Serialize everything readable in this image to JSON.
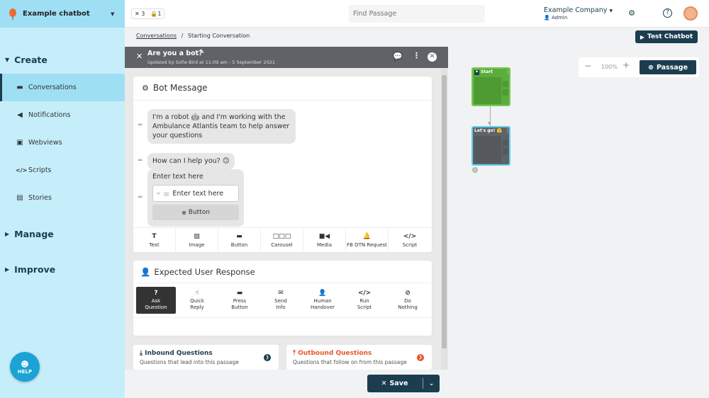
{
  "sidebar": {
    "chatbot_name": "Example chatbot",
    "groups": {
      "create": "Create",
      "manage": "Manage",
      "improve": "Improve"
    },
    "items": [
      {
        "label": "Conversations",
        "icon": "chat-bubble-icon"
      },
      {
        "label": "Notifications",
        "icon": "megaphone-icon"
      },
      {
        "label": "Webviews",
        "icon": "window-icon"
      },
      {
        "label": "Scripts",
        "icon": "code-icon"
      },
      {
        "label": "Stories",
        "icon": "stack-icon"
      }
    ],
    "help_label": "HELP"
  },
  "topbar": {
    "counts": {
      "tools": "3",
      "locks": "1"
    },
    "search_placeholder": "Find Passage",
    "company": "Example Company",
    "role": "Admin"
  },
  "breadcrumb": {
    "root": "Conversations",
    "separator": "/",
    "current": "Starting Conversation"
  },
  "test_chatbot_label": "Test Chatbot",
  "passage": {
    "title": "Are you a bot?",
    "updated": "Updated by Sofie Bird at 11:09 am - 5 September 2021"
  },
  "bot_message": {
    "heading": "Bot Message",
    "bubbles": [
      "I'm a robot 🤖 and I'm working with the Ambulance Atlantis team to help answer your questions",
      "How can I help you? 🙃"
    ],
    "text_placeholder": "Enter text here",
    "button_placeholder": "Enter text here",
    "add_button_label": "Button",
    "tools": [
      "Text",
      "Image",
      "Button",
      "Carousel",
      "Media",
      "FB OTN Request",
      "Script"
    ]
  },
  "expected_response": {
    "heading": "Expected User Response",
    "options": [
      [
        "Ask",
        "Question"
      ],
      [
        "Quick",
        "Reply"
      ],
      [
        "Press",
        "Button"
      ],
      [
        "Send",
        "Info"
      ],
      [
        "Human",
        "Handover"
      ],
      [
        "Run",
        "Script"
      ],
      [
        "Do",
        "Nothing"
      ]
    ],
    "active_index": 0
  },
  "inbound": {
    "title": "Inbound Questions",
    "subtitle": "Questions that lead into this passage",
    "color": "#1c3d4f"
  },
  "outbound": {
    "title": "Outbound Questions",
    "subtitle": "Questions that follow on from this passage",
    "color": "#e8562a"
  },
  "save_label": "Save",
  "canvas": {
    "zoom": "100%",
    "add_passage_label": "Passage",
    "nodes": [
      {
        "title": "Start",
        "color": "#5aad3c"
      },
      {
        "title": "Let's go! 🤗",
        "color": "#5f6367",
        "border": "#5fd0ef"
      }
    ]
  },
  "colors": {
    "primary": "#1c3d4f",
    "sidebar": "#c6eefa",
    "sidebar_active": "#9fdff4"
  }
}
